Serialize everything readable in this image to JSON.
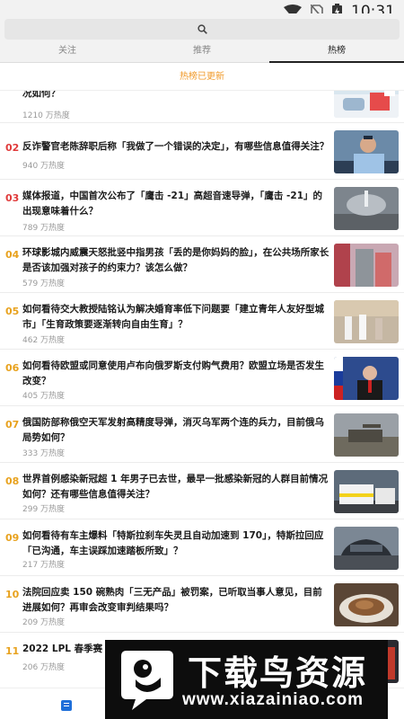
{
  "status_bar": {
    "time": "10:31",
    "icons": [
      "wifi-icon",
      "no-sim-icon",
      "battery-charging-icon"
    ]
  },
  "search": {
    "icon": "search-icon"
  },
  "tabs": [
    {
      "label": "关注",
      "active": false
    },
    {
      "label": "推荐",
      "active": false
    },
    {
      "label": "热榜",
      "active": true
    }
  ],
  "notice": "热榜已更新",
  "hot_list": [
    {
      "rank": "",
      "title": "况如何？",
      "heat": "1210 万热度"
    },
    {
      "rank": "02",
      "title": "反诈警官老陈辞职后称「我做了一个错误的决定」，有哪些信息值得关注？",
      "heat": "940 万热度"
    },
    {
      "rank": "03",
      "title": "媒体报道，中国首次公布了「鹰击 -21」高超音速导弹，「鹰击 -21」的出现意味着什么？",
      "heat": "789 万热度"
    },
    {
      "rank": "04",
      "title": "环球影城内威震天怒批竖中指男孩「丢的是你妈妈的脸」，在公共场所家长是否该加强对孩子的约束力？该怎么做？",
      "heat": "579 万热度"
    },
    {
      "rank": "05",
      "title": "如何看待交大教授陆铭认为解决婚育率低下问题要「建立青年人友好型城市」「生育政策要逐渐转向自由生育」？",
      "heat": "462 万热度"
    },
    {
      "rank": "06",
      "title": "如何看待欧盟或同意使用卢布向俄罗斯支付购气费用？欧盟立场是否发生改变？",
      "heat": "405 万热度"
    },
    {
      "rank": "07",
      "title": "俄国防部称俄空天军发射高精度导弹，消灭乌军两个连的兵力，目前俄乌局势如何？",
      "heat": "333 万热度"
    },
    {
      "rank": "08",
      "title": "世界首例感染新冠超 1 年男子已去世，最早一批感染新冠的人群目前情况如何？还有哪些信息值得关注？",
      "heat": "299 万热度"
    },
    {
      "rank": "09",
      "title": "如何看待有车主爆料「特斯拉刹车失灵且自动加速到 170」，特斯拉回应「已沟通，车主误踩加速踏板所致」？",
      "heat": "217 万热度"
    },
    {
      "rank": "10",
      "title": "法院回应卖 150 碗熟肉「三无产品」被罚案，已听取当事人意见，目前进展如何？再审会改变审判结果吗？",
      "heat": "209 万热度"
    },
    {
      "rank": "11",
      "title": "2022 LPL 春季赛 RNG",
      "heat": "206 万热度"
    }
  ],
  "bottom_nav": {
    "icon": "feed-icon"
  },
  "watermark": {
    "logo_icon": "bird-logo-icon",
    "name": "下载鸟资源",
    "url": "www.xiazainiao.com"
  },
  "colors": {
    "rank_top": "#e03a3a",
    "rank_other": "#e8a21e",
    "notice": "#f09a2a",
    "nav_active": "#1e6fd9"
  }
}
